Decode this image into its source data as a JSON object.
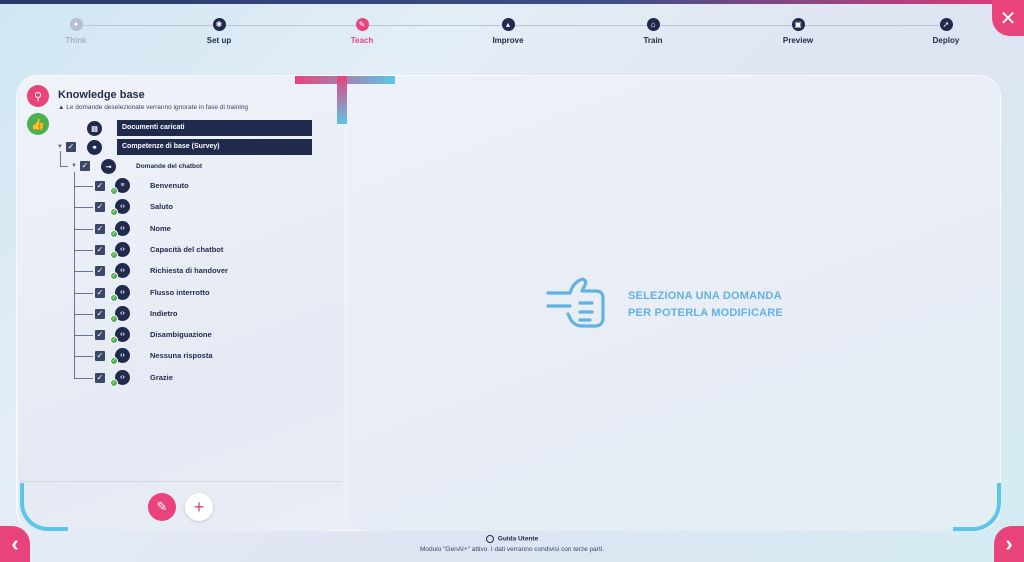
{
  "stepper": {
    "steps": [
      {
        "label": "Think",
        "state": "disabled",
        "icon": "lightbulb-icon"
      },
      {
        "label": "Set up",
        "state": "done",
        "icon": "gear-icon"
      },
      {
        "label": "Teach",
        "state": "active",
        "icon": "pencil-icon"
      },
      {
        "label": "Improve",
        "state": "done",
        "icon": "chart-icon"
      },
      {
        "label": "Train",
        "state": "done",
        "icon": "home-icon"
      },
      {
        "label": "Preview",
        "state": "done",
        "icon": "preview-icon"
      },
      {
        "label": "Deploy",
        "state": "done",
        "icon": "rocket-icon"
      }
    ]
  },
  "knowledge": {
    "title": "Knowledge base",
    "warning": "Le domande deselezionate verranno ignorate in fase di training",
    "documents_label": "Documenti caricati",
    "survey_label": "Competenze di base (Survey)",
    "chatbot_questions_label": "Domande del chatbot",
    "items": [
      {
        "label": "Benvenuto"
      },
      {
        "label": "Saluto"
      },
      {
        "label": "Nome"
      },
      {
        "label": "Capacità del chatbot"
      },
      {
        "label": "Richiesta di handover"
      },
      {
        "label": "Flusso interrotto"
      },
      {
        "label": "Indietro"
      },
      {
        "label": "Disambiguazione"
      },
      {
        "label": "Nessuna risposta"
      },
      {
        "label": "Grazie"
      }
    ]
  },
  "placeholder": {
    "line1": "SELEZIONA UNA DOMANDA",
    "line2": "PER POTERLA MODIFICARE"
  },
  "footer": {
    "guide": "Guida Utente",
    "note": "Modulo \"GenAI+\" attivo. I dati verranno condivisi con terze parti."
  },
  "colors": {
    "accent": "#e8437b",
    "navy": "#1f2a4d",
    "cyan": "#5bc6e8",
    "green": "#4caf50"
  }
}
